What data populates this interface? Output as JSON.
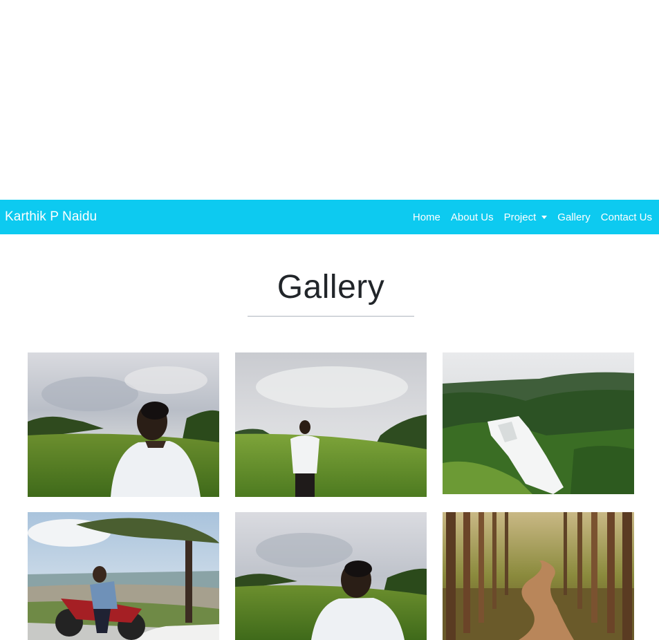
{
  "navbar": {
    "brand": "Karthik P Naidu",
    "links": [
      {
        "label": "Home"
      },
      {
        "label": "About Us"
      },
      {
        "label": "Project"
      },
      {
        "label": "Gallery"
      },
      {
        "label": "Contact Us"
      }
    ],
    "background_color": "#0dcaf0"
  },
  "gallery": {
    "title": "Gallery",
    "photos": [
      {
        "subject": "man in white shirt facing misty green hills (close-up)"
      },
      {
        "subject": "man standing in green meadow with misty forest"
      },
      {
        "subject": "waterfall in green forested valley"
      },
      {
        "subject": "man sitting on red motorcycle under a tree overlooking town"
      },
      {
        "subject": "man in white shirt facing misty hills (close-up)"
      },
      {
        "subject": "dirt path through tall forest trees"
      }
    ]
  }
}
